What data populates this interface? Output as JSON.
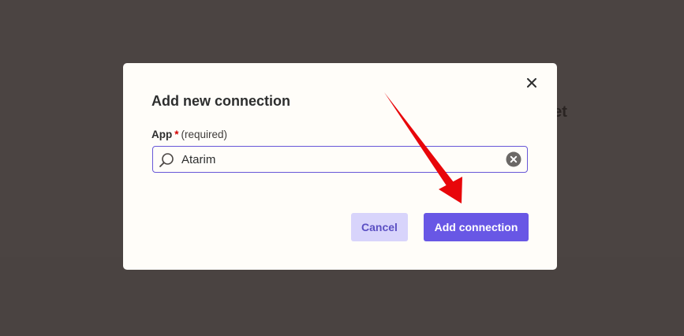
{
  "background": {
    "partial_text": "yet"
  },
  "modal": {
    "title": "Add new connection",
    "field": {
      "label": "App",
      "required_marker": "*",
      "hint": "(required)",
      "value": "Atarim"
    },
    "buttons": {
      "cancel_label": "Cancel",
      "add_label": "Add connection"
    }
  },
  "icons": {
    "close": "close-icon",
    "search": "search-icon",
    "clear": "clear-icon"
  },
  "colors": {
    "accent": "#6857e5",
    "accent_light": "#d8d4fb",
    "annotation_arrow": "#e8060a",
    "required": "#d40000",
    "backdrop": "#4b4442"
  }
}
